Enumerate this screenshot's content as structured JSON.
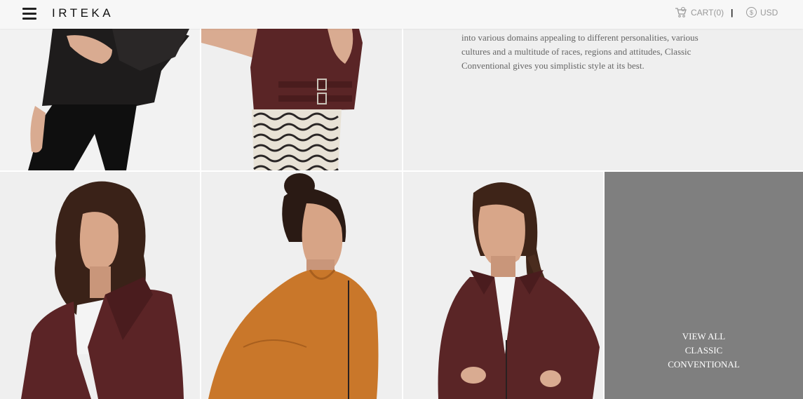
{
  "header": {
    "logo": "IRTEKA",
    "cart_label": "CART(0)",
    "divider": "|",
    "currency_symbol": "$",
    "currency_label": "USD"
  },
  "collection": {
    "description": "into various domains appealing to different personalities, various cultures and a multitude of races, regions and attitudes, Classic Conventional gives you simplistic style at its best.",
    "view_all_lines": [
      "VIEW ALL",
      "CLASSIC",
      "CONVENTIONAL"
    ]
  },
  "colors": {
    "tile_bg": "#efefef",
    "view_all_bg": "#7f7f7f",
    "burgundy_leather": "#5a2526",
    "tan_leather": "#c9772a",
    "black_leather": "#1e1c1c"
  }
}
